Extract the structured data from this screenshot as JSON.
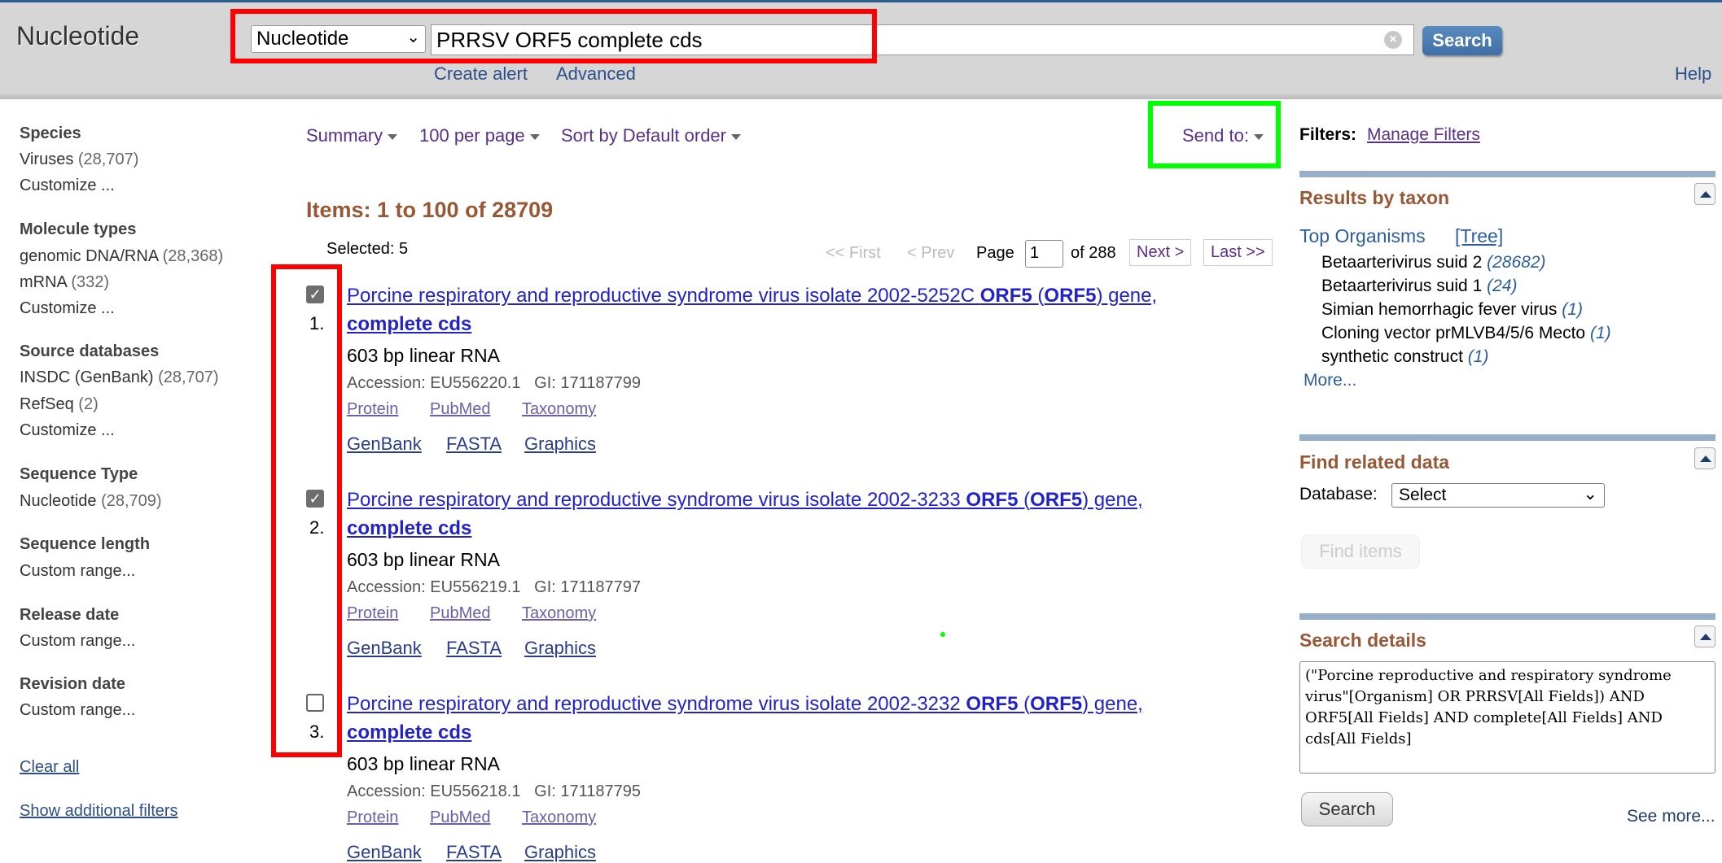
{
  "header": {
    "title": "Nucleotide",
    "db_select": "Nucleotide",
    "query": "PRRSV ORF5 complete cds",
    "search_button": "Search",
    "create_alert": "Create alert",
    "advanced": "Advanced",
    "help": "Help",
    "clear_icon": "×"
  },
  "sidebar": {
    "species_h": "Species",
    "viruses": "Viruses",
    "viruses_c": "(28,707)",
    "customize1": "Customize ...",
    "mol_h": "Molecule types",
    "genomic": "genomic DNA/RNA",
    "genomic_c": "(28,368)",
    "mrna": "mRNA",
    "mrna_c": "(332)",
    "customize2": "Customize ...",
    "src_h": "Source databases",
    "insdc": "INSDC (GenBank)",
    "insdc_c": "(28,707)",
    "refseq": "RefSeq",
    "refseq_c": "(2)",
    "customize3": "Customize ...",
    "seqtype_h": "Sequence Type",
    "nucleotide": "Nucleotide",
    "nucleotide_c": "(28,709)",
    "seqlen_h": "Sequence length",
    "custom1": "Custom range...",
    "release_h": "Release date",
    "custom2": "Custom range...",
    "revision_h": "Revision date",
    "custom3": "Custom range...",
    "clear_all": "Clear all",
    "show_more": "Show additional filters"
  },
  "toolbar": {
    "summary": "Summary",
    "per_page": "100 per page",
    "sort": "Sort by Default order",
    "send_to": "Send to:"
  },
  "results": {
    "items_heading": "Items: 1 to 100 of 28709",
    "selected": "Selected: 5",
    "pager": {
      "first": "<< First",
      "prev": "< Prev",
      "page_label": "Page",
      "page": "1",
      "of": "of 288",
      "next": "Next >",
      "last": "Last >>"
    },
    "list": [
      {
        "num": "1.",
        "checked": true,
        "title_a": "Porcine respiratory and reproductive syndrome virus isolate 2002-5252C ",
        "orf": "ORF5",
        "paren_open": " (",
        "orf2": "ORF5",
        "title_b": ") gene,",
        "title_c": "complete cds",
        "desc": "603 bp linear RNA",
        "accession": "Accession: EU556220.1   GI: 171187799",
        "l_protein": "Protein",
        "l_pubmed": "PubMed",
        "l_taxonomy": "Taxonomy",
        "l_genbank": "GenBank",
        "l_fasta": "FASTA",
        "l_graphics": "Graphics"
      },
      {
        "num": "2.",
        "checked": true,
        "title_a": "Porcine respiratory and reproductive syndrome virus isolate 2002-3233 ",
        "orf": "ORF5",
        "paren_open": " (",
        "orf2": "ORF5",
        "title_b": ") gene,",
        "title_c": "complete cds",
        "desc": "603 bp linear RNA",
        "accession": "Accession: EU556219.1   GI: 171187797",
        "l_protein": "Protein",
        "l_pubmed": "PubMed",
        "l_taxonomy": "Taxonomy",
        "l_genbank": "GenBank",
        "l_fasta": "FASTA",
        "l_graphics": "Graphics"
      },
      {
        "num": "3.",
        "checked": false,
        "title_a": "Porcine respiratory and reproductive syndrome virus isolate 2002-3232 ",
        "orf": "ORF5",
        "paren_open": " (",
        "orf2": "ORF5",
        "title_b": ") gene,",
        "title_c": "complete cds",
        "desc": "603 bp linear RNA",
        "accession": "Accession: EU556218.1   GI: 171187795",
        "l_protein": "Protein",
        "l_pubmed": "PubMed",
        "l_taxonomy": "Taxonomy",
        "l_genbank": "GenBank",
        "l_fasta": "FASTA",
        "l_graphics": "Graphics"
      }
    ]
  },
  "right": {
    "filters_label": "Filters:",
    "manage_filters": "Manage Filters",
    "taxon_h": "Results by taxon",
    "top_org": "Top Organisms",
    "tree": "[Tree]",
    "orgs": [
      {
        "n": "Betaarterivirus suid 2",
        "c": "(28682)"
      },
      {
        "n": "Betaarterivirus suid 1",
        "c": "(24)"
      },
      {
        "n": "Simian hemorrhagic fever virus",
        "c": "(1)"
      },
      {
        "n": "Cloning vector prMLVB4/5/6 Mecto",
        "c": "(1)"
      },
      {
        "n": "synthetic construct",
        "c": "(1)"
      }
    ],
    "more": "More...",
    "related_h": "Find related data",
    "database_label": "Database:",
    "database_select": "Select",
    "find_items": "Find items",
    "details_h": "Search details",
    "details_text": "(\"Porcine reproductive and respiratory syndrome virus\"[Organism] OR PRRSV[All Fields]) AND ORF5[All Fields] AND complete[All Fields] AND cds[All Fields]",
    "search_button": "Search",
    "see_more": "See more..."
  },
  "colors": {
    "heading": "#985735",
    "link": "#2222cc",
    "annotation_red": "#ff0000",
    "annotation_green": "#00ff00"
  }
}
